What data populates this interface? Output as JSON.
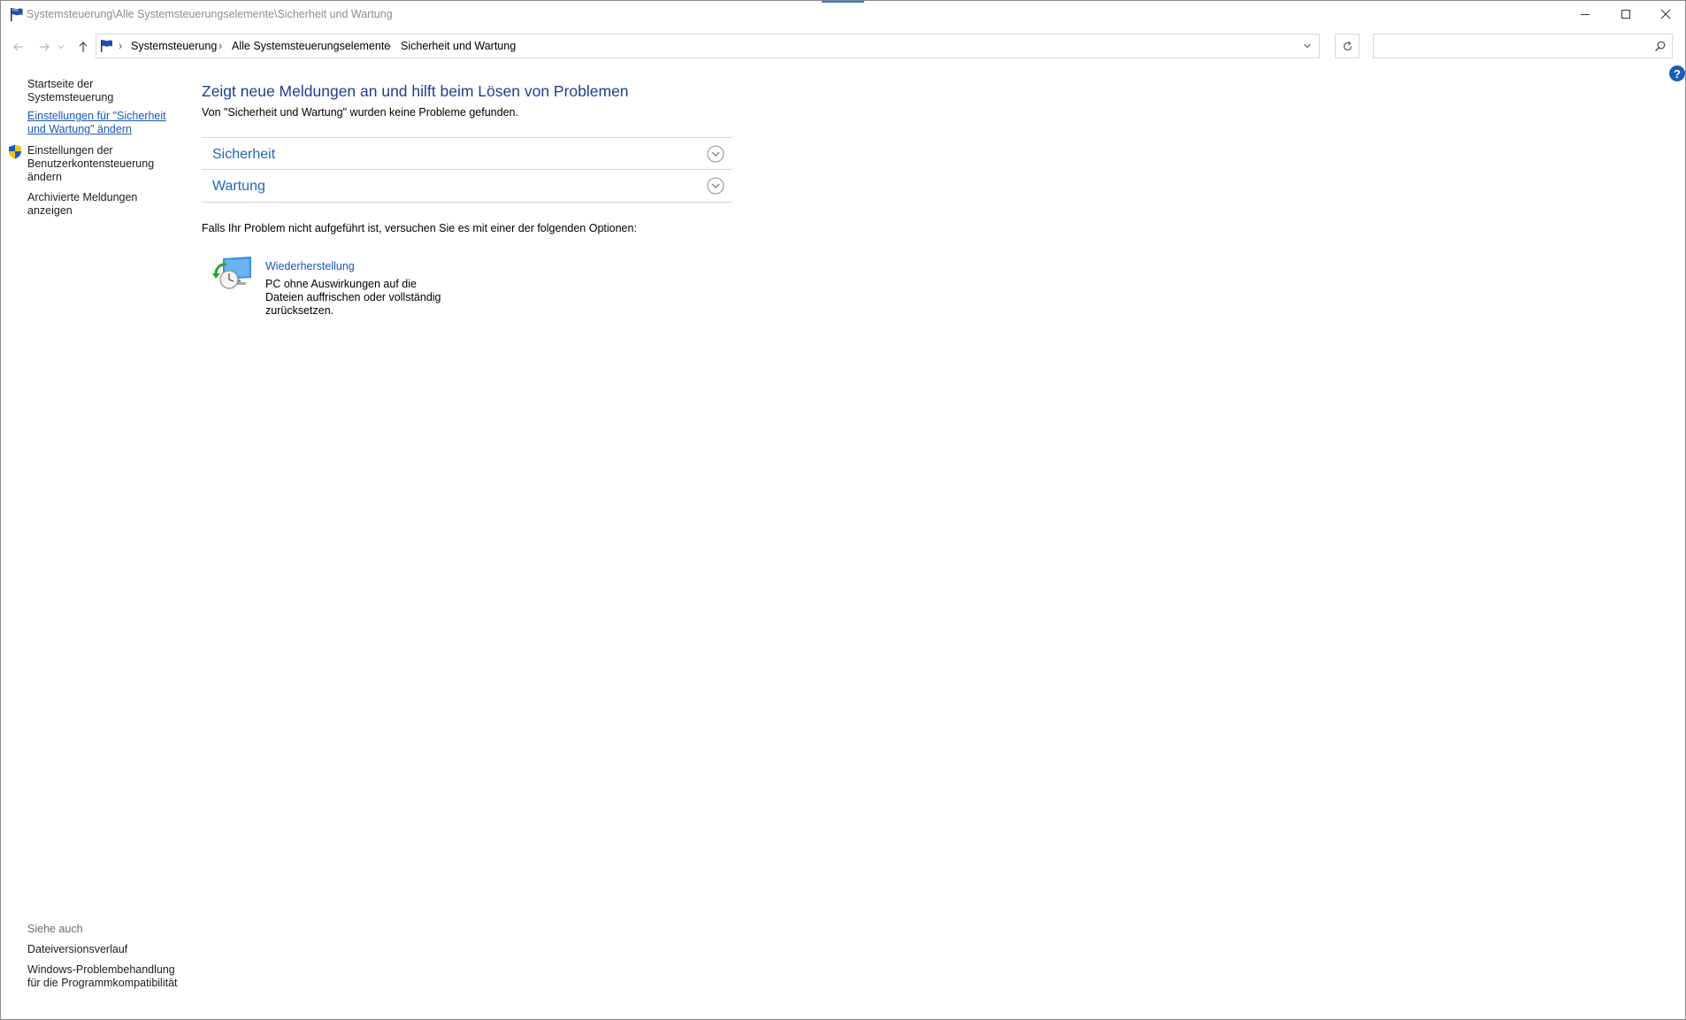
{
  "window": {
    "title": "Systemsteuerung\\Alle Systemsteuerungselemente\\Sicherheit und Wartung"
  },
  "navigation": {
    "breadcrumbs": [
      "Systemsteuerung",
      "Alle Systemsteuerungselemente",
      "Sicherheit und Wartung"
    ],
    "search_placeholder": ""
  },
  "left_pane": {
    "links": [
      "Startseite der Systemsteuerung",
      "Einstellungen für \"Sicherheit und Wartung\" ändern",
      "Einstellungen der Benutzerkontensteuerung ändern",
      "Archivierte Meldungen anzeigen"
    ],
    "see_also_label": "Siehe auch",
    "see_also_links": [
      "Dateiversionsverlauf",
      "Windows-Problembehandlung für die Programmkompatibilität"
    ]
  },
  "main": {
    "heading": "Zeigt neue Meldungen an und hilft beim Lösen von Problemen",
    "status": "Von \"Sicherheit und Wartung\" wurden keine Probleme gefunden.",
    "sections": [
      "Sicherheit",
      "Wartung"
    ],
    "options_text": "Falls Ihr Problem nicht aufgeführt ist, versuchen Sie es mit einer der folgenden Optionen:",
    "recovery": {
      "title": "Wiederherstellung",
      "description": "PC ohne Auswirkungen auf die Dateien auffrischen oder vollständig zurücksetzen."
    }
  },
  "colors": {
    "link": "#1a56b9",
    "heading": "#1e3e95",
    "section_title": "#1e67b8",
    "help_badge": "#1b5fb3"
  },
  "icons": [
    "flag-icon",
    "back-arrow-icon",
    "forward-arrow-icon",
    "recent-dropdown-icon",
    "up-arrow-icon",
    "refresh-icon",
    "search-icon",
    "help-icon",
    "shield-icon",
    "chevron-down-icon",
    "recovery-icon",
    "minimize-icon",
    "maximize-icon",
    "close-icon"
  ]
}
